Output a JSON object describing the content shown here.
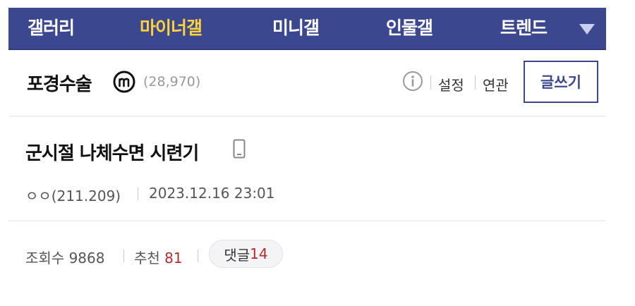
{
  "nav": {
    "items": [
      {
        "label": "갤러리"
      },
      {
        "label": "마이너갤",
        "active": true
      },
      {
        "label": "미니갤"
      },
      {
        "label": "인물갤"
      },
      {
        "label": "트렌드"
      }
    ],
    "dropdown_icon": "triangle-down-icon",
    "background_color": "#3b4890",
    "active_color": "#fdd13a"
  },
  "gallery": {
    "name": "포경수술",
    "badge_icon": "minor-gallery-m-icon",
    "subscriber_count": "(28,970)",
    "info_icon": "info-circle-icon",
    "settings_label": "설정",
    "related_label": "연관",
    "write_label": "글쓰기"
  },
  "post": {
    "title": "군시절 나체수면 시련기",
    "device_icon": "mobile-phone-icon",
    "author": "ㅇㅇ(211.209)",
    "datetime": "2023.12.16 23:01"
  },
  "stats": {
    "views_label": "조회수",
    "views": "9868",
    "recommend_label": "추천",
    "recommend": "81",
    "comments_label": "댓글",
    "comments": "14",
    "highlight_color": "#b32d2d"
  }
}
